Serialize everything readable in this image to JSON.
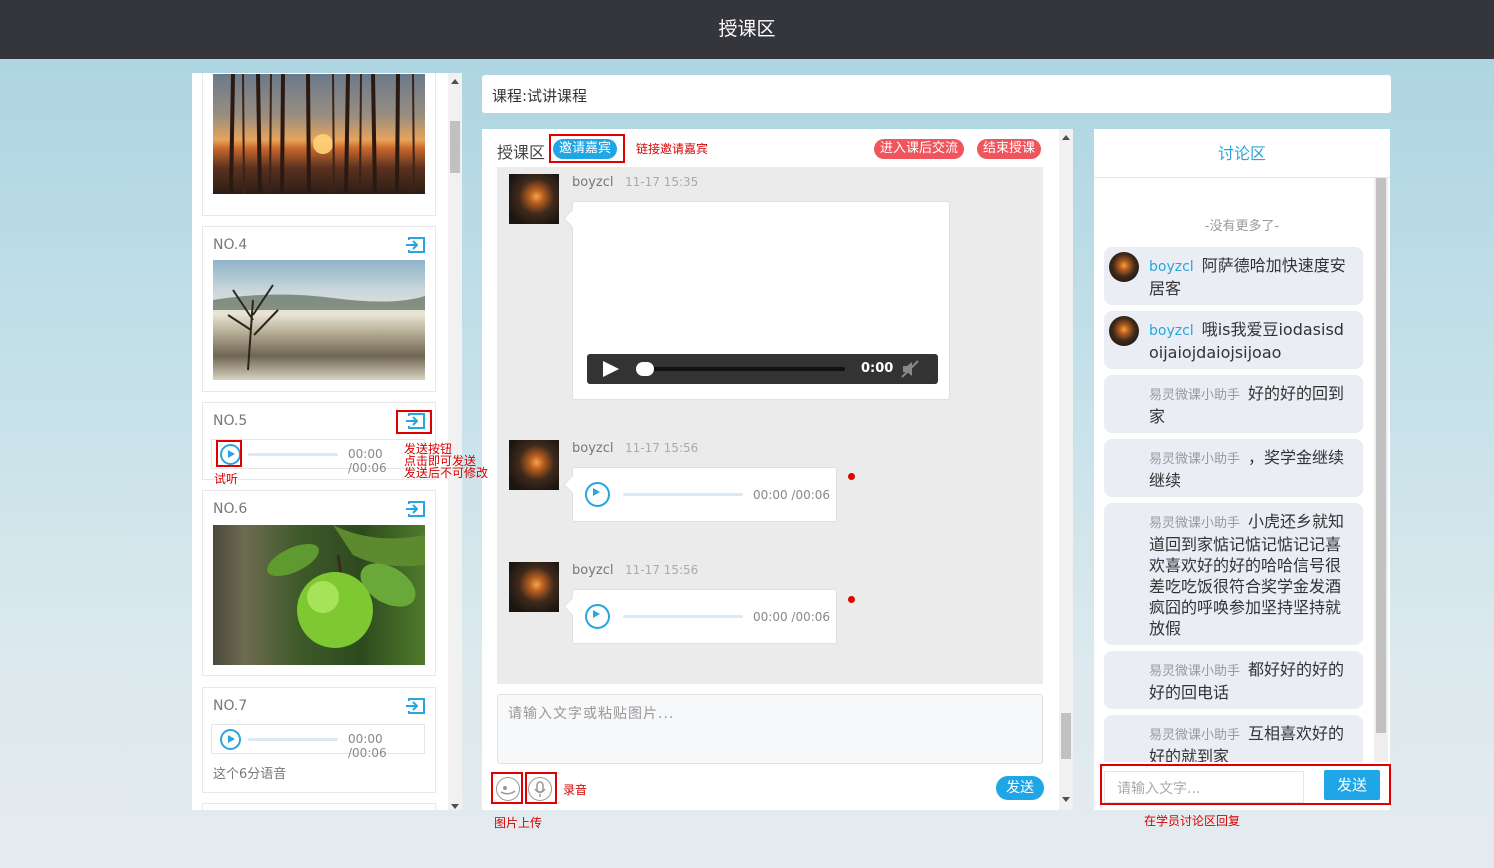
{
  "header": {
    "title": "授课区"
  },
  "left": {
    "cards": [
      {
        "no": "NO.4"
      },
      {
        "no": "NO.5",
        "audio_time": "00:00 /00:06"
      },
      {
        "no": "NO.6"
      },
      {
        "no": "NO.7",
        "audio_time": "00:00 /00:06",
        "caption": "这个6分语音"
      }
    ]
  },
  "course": {
    "label": "课程:试讲课程"
  },
  "teach": {
    "title": "授课区",
    "invite_label": "邀请嘉宾",
    "enter_label": "进入课后交流",
    "end_label": "结束授课",
    "messages": [
      {
        "user": "boyzcl",
        "time": "11-17 15:35",
        "player_time": "0:00"
      },
      {
        "user": "boyzcl",
        "time": "11-17 15:56",
        "audio_time": "00:00 /00:06"
      },
      {
        "user": "boyzcl",
        "time": "11-17 15:56",
        "audio_time": "00:00 /00:06"
      }
    ],
    "input_placeholder": "请输入文字或粘贴图片...",
    "send_label": "发送"
  },
  "discussion": {
    "title": "讨论区",
    "no_more": "-没有更多了-",
    "messages": [
      {
        "name": "boyzcl",
        "text": "阿萨德哈加快速度安居客"
      },
      {
        "name": "boyzcl",
        "text": "哦is我爱豆iodasisdoijaiojdaiojsijoao"
      },
      {
        "name": "易灵微课小助手",
        "text": "好的好的回到家"
      },
      {
        "name": "易灵微课小助手",
        "text": "，奖学金继续继续"
      },
      {
        "name": "易灵微课小助手",
        "text": "小虎还乡就知道回到家惦记惦记惦记记喜欢喜欢好的好的哈哈信号很差吃吃饭很符合奖学金发酒疯囧的呼唤参加坚持坚持就放假"
      },
      {
        "name": "易灵微课小助手",
        "text": "都好好的好的好的回电话"
      },
      {
        "name": "易灵微课小助手",
        "text": "互相喜欢好的好的就到家"
      }
    ],
    "input_placeholder": "请输入文字...",
    "send_label": "发送"
  },
  "annotations": {
    "invite_link": "链接邀请嘉宾",
    "send_btn_1": "发送按钮",
    "send_btn_2": "点击即可发送",
    "send_btn_3": "发送后不可修改",
    "listen": "试听",
    "image_upload": "图片上传",
    "record": "录音",
    "reply": "在学员讨论区回复"
  },
  "colors": {
    "accent": "#1ea6e6",
    "danger": "#f0555d",
    "annotation": "#e00000"
  }
}
